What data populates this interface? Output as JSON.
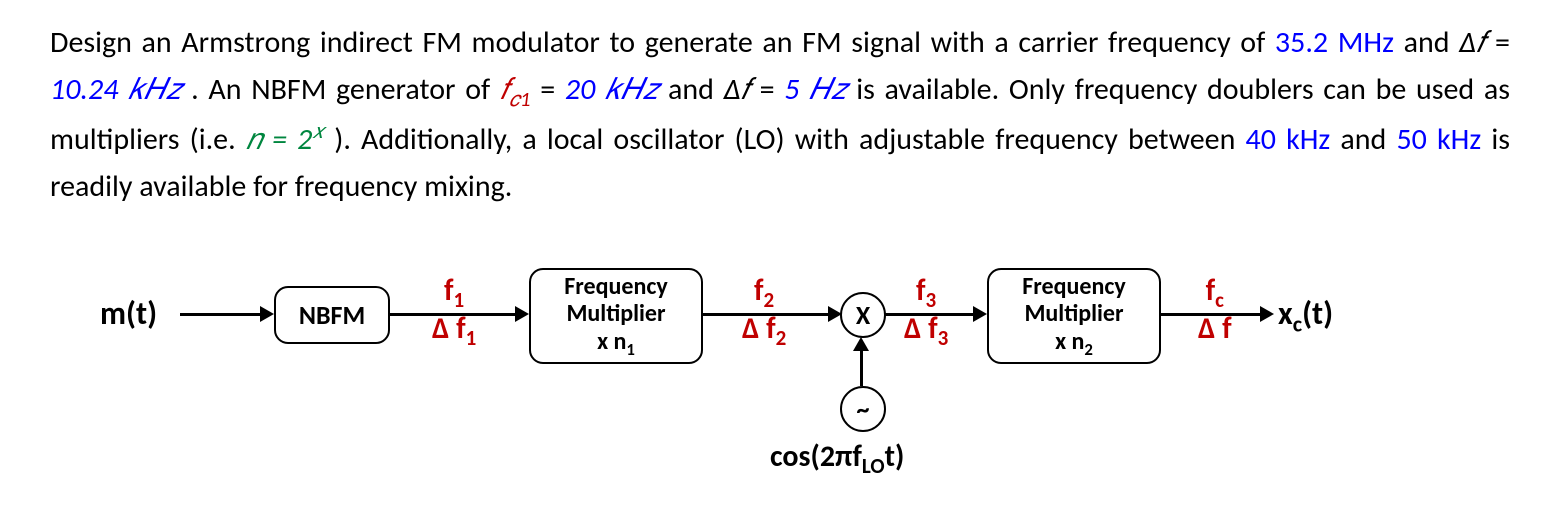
{
  "problem": {
    "intro": "Design an Armstrong indirect FM modulator to generate an FM signal with a carrier frequency of ",
    "val1": "35.2 MHz",
    "and1": " and ",
    "df_sym": "Δ𝑓",
    "eq1": " = ",
    "val2": "10.24 𝑘𝐻𝑧",
    "nb1": ". An NBFM generator of ",
    "fc1": "𝑓",
    "fc1_sub": "𝑐1",
    "eq2": " = ",
    "val3": "20 𝑘𝐻𝑧",
    "and2": " and ",
    "df_sym2": "Δ𝑓",
    "eq3": " = ",
    "val4": "5 𝐻𝑧",
    "avail": " is available. Only frequency doublers can be used as multipliers (i.e. ",
    "nexpr": "𝑛 = 2",
    "nexpr_sup": "𝑥",
    "after_n": "). Additionally, a local oscillator (LO) with adjustable frequency between ",
    "val5": "40 kHz",
    "and3": " and ",
    "val6": "50 kHz",
    "tail": " is readily available for frequency mixing."
  },
  "diagram": {
    "input": "m(t)",
    "nbfm": "NBFM",
    "f1_top": "f",
    "f1_sub": "1",
    "df1_top": "Δ f",
    "df1_sub": "1",
    "mult1_l1": "Frequency",
    "mult1_l2": "Multiplier",
    "mult1_l3a": "x n",
    "mult1_l3b": "1",
    "f2_top": "f",
    "f2_sub": "2",
    "df2_top": "Δ f",
    "df2_sub": "2",
    "mixer": "X",
    "osc_sym": "~",
    "lo": "cos(2πf",
    "lo_sub": "LO",
    "lo_tail": "t)",
    "f3_top": "f",
    "f3_sub": "3",
    "df3_top": "Δ f",
    "df3_sub": "3",
    "mult2_l1": "Frequency",
    "mult2_l2": "Multiplier",
    "mult2_l3a": "x n",
    "mult2_l3b": "2",
    "fc_top": "f",
    "fc_sub": "c",
    "dfc_top": "Δ f",
    "output": "x",
    "output_sub": "c",
    "output_tail": "(t)"
  }
}
